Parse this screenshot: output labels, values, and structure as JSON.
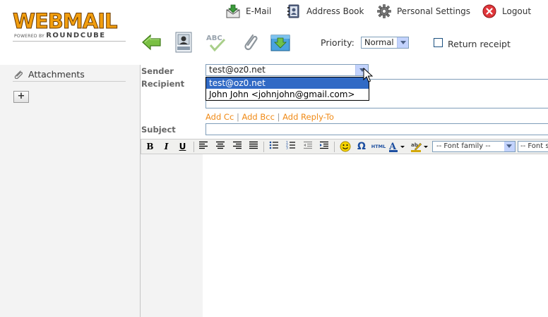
{
  "logo": {
    "word": "WEBMAIL",
    "sub_small": "POWERED BY",
    "sub_brand": "ROUNDCUBE"
  },
  "nav": {
    "email": "E-Mail",
    "address_book": "Address Book",
    "settings": "Personal Settings",
    "logout": "Logout"
  },
  "toolbar": {
    "priority_label": "Priority:",
    "priority_value": "Normal",
    "receipt_label": "Return receipt"
  },
  "sidebar": {
    "title": "Attachments",
    "add_label": "+"
  },
  "form": {
    "sender_label": "Sender",
    "recipient_label": "Recipient",
    "subject_label": "Subject",
    "sender_value": "test@oz0.net",
    "sender_options": [
      "test@oz0.net",
      "John John <johnjohn@gmail.com>"
    ],
    "add_cc": "Add Cc",
    "add_bcc": "Add Bcc",
    "add_reply_to": "Add Reply-To",
    "link_sep": "|"
  },
  "editor": {
    "bold": "B",
    "italic": "I",
    "underline": "U",
    "html": "HTML",
    "font_family": "-- Font family --",
    "font_size": "-- Font size --"
  },
  "colors": {
    "logo_orange": "#f29e0e",
    "link_orange": "#f08a16",
    "select_blue": "#316ac5",
    "label_gray": "#666666"
  }
}
